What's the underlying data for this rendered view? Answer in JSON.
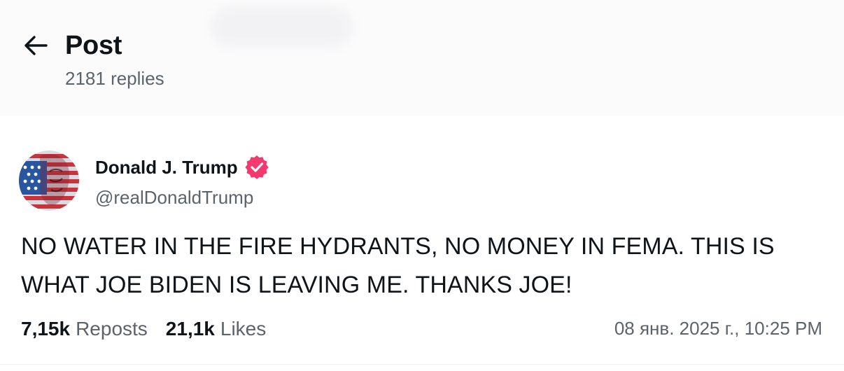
{
  "header": {
    "back_icon": "arrow-left-icon",
    "title": "Post",
    "replies": "2181 replies"
  },
  "author": {
    "name": "Donald J. Trump",
    "handle": "@realDonaldTrump",
    "verified_icon": "verified-badge-icon",
    "verified_color": "#f5386e"
  },
  "post": {
    "text": "NO WATER IN THE FIRE HYDRANTS, NO MONEY IN FEMA. THIS IS WHAT JOE BIDEN IS LEAVING ME. THANKS JOE!"
  },
  "stats": {
    "reposts_count": "7,15k",
    "reposts_label": "Reposts",
    "likes_count": "21,1k",
    "likes_label": "Likes",
    "timestamp": "08 янв. 2025 г., 10:25 PM"
  }
}
